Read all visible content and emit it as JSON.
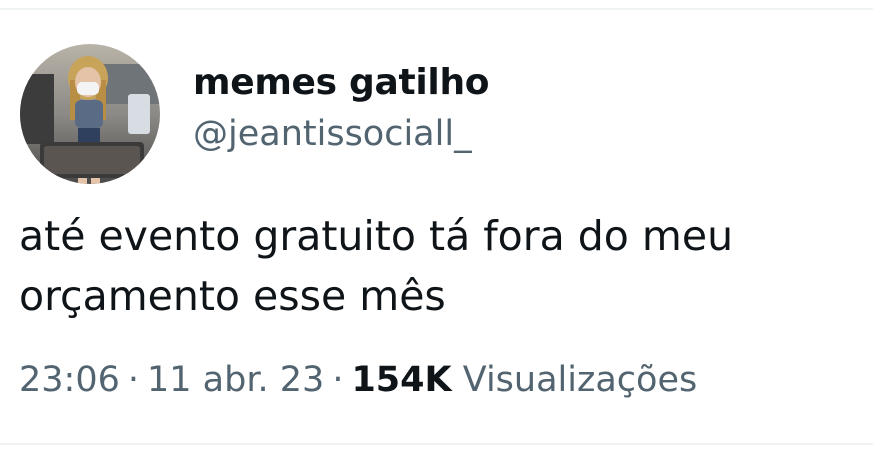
{
  "author": {
    "display_name": "memes gatilho",
    "handle": "@jeantissociall_"
  },
  "tweet": {
    "text_line1": "até evento gratuito tá fora do meu",
    "text_line2": "orçamento esse mês"
  },
  "meta": {
    "time": "23:06",
    "date": "11 abr. 23",
    "separator": "·",
    "views_count": "154K",
    "views_label": "Visualizações"
  },
  "colors": {
    "text_primary": "#0f1419",
    "text_secondary": "#536471",
    "divider": "#eff3f4"
  },
  "icons": {
    "avatar": "profile-photo"
  }
}
